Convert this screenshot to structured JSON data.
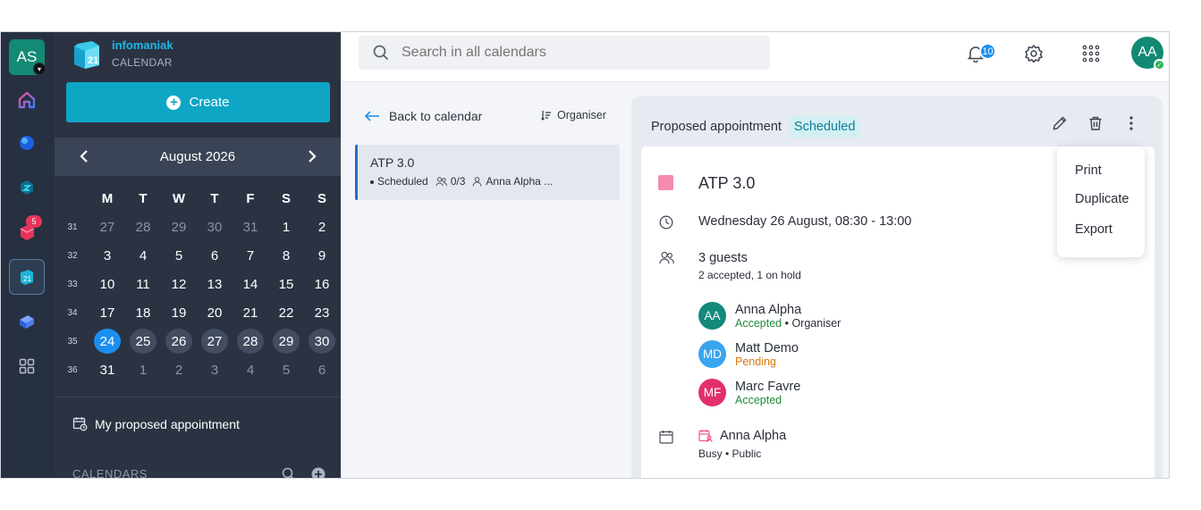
{
  "rail": {
    "avatar_initials": "AS",
    "mail_badge": "5"
  },
  "brand": {
    "name": "infomaniak",
    "product": "CALENDAR"
  },
  "sidebar": {
    "create_label": "Create",
    "month_title": "August  2026",
    "weekdays": [
      "M",
      "T",
      "W",
      "T",
      "F",
      "S",
      "S"
    ],
    "weeks": [
      {
        "num": "31",
        "days": [
          "27",
          "28",
          "29",
          "30",
          "31",
          "1",
          "2"
        ]
      },
      {
        "num": "32",
        "days": [
          "3",
          "4",
          "5",
          "6",
          "7",
          "8",
          "9"
        ]
      },
      {
        "num": "33",
        "days": [
          "10",
          "11",
          "12",
          "13",
          "14",
          "15",
          "16"
        ]
      },
      {
        "num": "34",
        "days": [
          "17",
          "18",
          "19",
          "20",
          "21",
          "22",
          "23"
        ]
      },
      {
        "num": "35",
        "days": [
          "24",
          "25",
          "26",
          "27",
          "28",
          "29",
          "30"
        ]
      },
      {
        "num": "36",
        "days": [
          "31",
          "1",
          "2",
          "3",
          "4",
          "5",
          "6"
        ]
      }
    ],
    "my_proposed_label": "My proposed appointment",
    "calendars_header": "CALENDARS"
  },
  "topbar": {
    "search_placeholder": "Search in all calendars",
    "notifications_count": "10",
    "user_initials": "AA"
  },
  "list": {
    "back_label": "Back to calendar",
    "sort_label": "Organiser",
    "item": {
      "title": "ATP 3.0",
      "status": "Scheduled",
      "guests": "0/3",
      "organiser": "Anna Alpha ..."
    }
  },
  "detail": {
    "header_label": "Proposed appointment",
    "status_tag": "Scheduled",
    "title": "ATP 3.0",
    "color": "#f58bb1",
    "datetime": "Wednesday 26 August, 08:30 - 13:00",
    "guests_title": "3 guests",
    "guests_summary": "2 accepted, 1 on hold",
    "guests": [
      {
        "initials": "AA",
        "name": "Anna Alpha",
        "status": "Accepted",
        "role": "Organiser",
        "color": "#12897a"
      },
      {
        "initials": "MD",
        "name": "Matt Demo",
        "status": "Pending",
        "role": "",
        "color": "#3aa5ef"
      },
      {
        "initials": "MF",
        "name": "Marc Favre",
        "status": "Accepted",
        "role": "",
        "color": "#e1306c"
      }
    ],
    "calendar_owner": "Anna Alpha",
    "calendar_meta": "Busy • Public"
  },
  "menu": {
    "items": [
      "Print",
      "Duplicate",
      "Export"
    ]
  }
}
